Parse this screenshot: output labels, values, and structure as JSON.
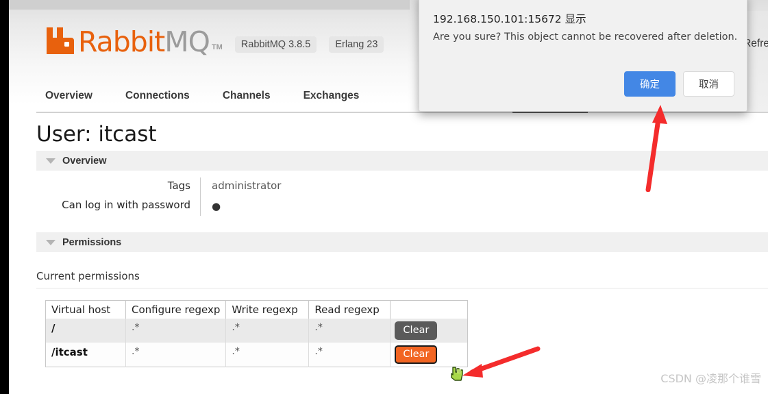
{
  "header": {
    "logo_rabbit": "Rabbit",
    "logo_mq": "MQ",
    "logo_tm": "TM",
    "logo_icon": "rabbitmq-logo-icon",
    "version_pills": [
      "RabbitMQ 3.8.5",
      "Erlang 23"
    ],
    "refresh_label": "Refre",
    "nav": [
      {
        "label": "Overview"
      },
      {
        "label": "Connections"
      },
      {
        "label": "Channels"
      },
      {
        "label": "Exchanges"
      }
    ]
  },
  "main": {
    "page_title": "User: itcast",
    "overview_section": {
      "title": "Overview",
      "rows": [
        {
          "key": "Tags",
          "value": "administrator"
        },
        {
          "key": "Can log in with password",
          "value": "●"
        }
      ]
    },
    "permissions_section": {
      "title": "Permissions",
      "current_permissions_label": "Current permissions",
      "columns": [
        "Virtual host",
        "Configure regexp",
        "Write regexp",
        "Read regexp",
        ""
      ],
      "rows": [
        {
          "vhost": "/",
          "configure": ".*",
          "write": ".*",
          "read": ".*",
          "action_label": "Clear",
          "action_state": "normal"
        },
        {
          "vhost": "/itcast",
          "configure": ".*",
          "write": ".*",
          "read": ".*",
          "action_label": "Clear",
          "action_state": "active"
        }
      ]
    }
  },
  "dialog": {
    "title": "192.168.150.101:15672 显示",
    "message": "Are you sure? This object cannot be recovered after deletion.",
    "confirm_label": "确定",
    "cancel_label": "取消"
  },
  "annotations": {
    "arrow_to_confirm": "red-arrow-up-icon",
    "arrow_to_clear": "red-arrow-left-icon",
    "cursor": "green-hand-cursor-icon"
  },
  "watermark": {
    "text": "CSDN @凌那个谁雪"
  },
  "colors": {
    "brand_orange": "#e8610d",
    "button_orange": "#f26522",
    "button_grey": "#5a5a5a",
    "dialog_blue": "#4387e5",
    "annotation_red": "#f42c2c"
  }
}
